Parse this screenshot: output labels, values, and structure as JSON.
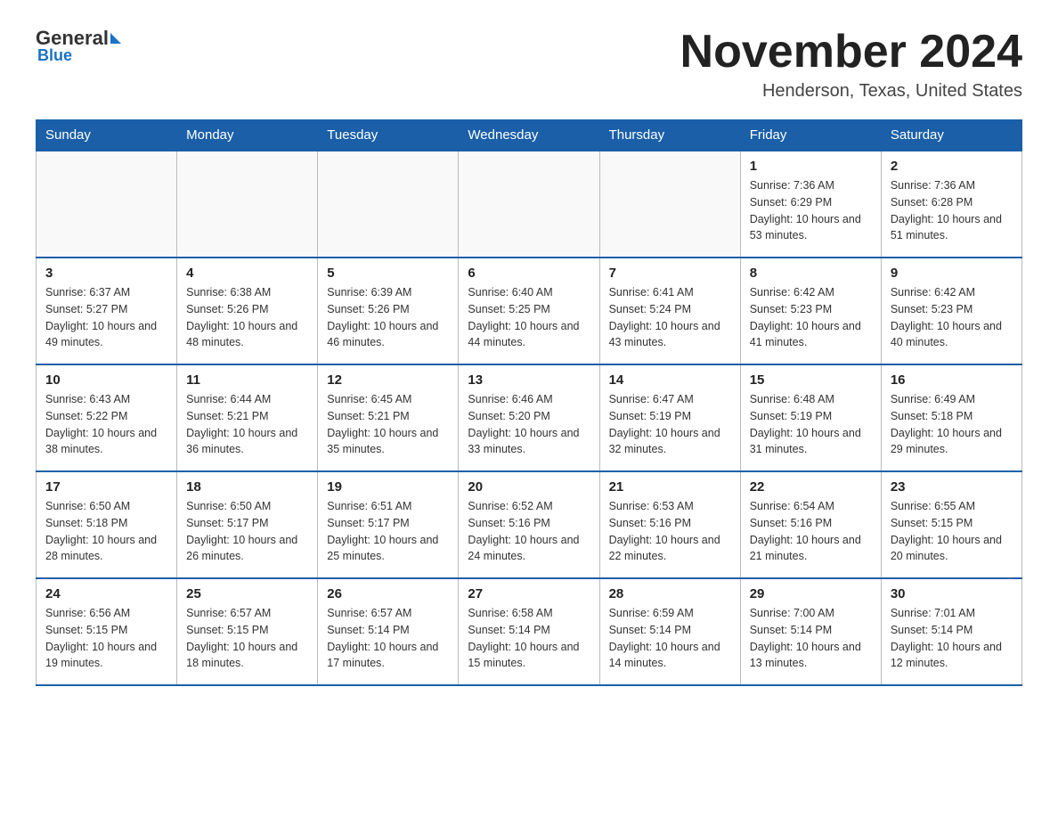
{
  "header": {
    "logo_general": "General",
    "logo_blue": "Blue",
    "month_title": "November 2024",
    "location": "Henderson, Texas, United States"
  },
  "calendar": {
    "days_of_week": [
      "Sunday",
      "Monday",
      "Tuesday",
      "Wednesday",
      "Thursday",
      "Friday",
      "Saturday"
    ],
    "weeks": [
      [
        {
          "day": "",
          "sunrise": "",
          "sunset": "",
          "daylight": ""
        },
        {
          "day": "",
          "sunrise": "",
          "sunset": "",
          "daylight": ""
        },
        {
          "day": "",
          "sunrise": "",
          "sunset": "",
          "daylight": ""
        },
        {
          "day": "",
          "sunrise": "",
          "sunset": "",
          "daylight": ""
        },
        {
          "day": "",
          "sunrise": "",
          "sunset": "",
          "daylight": ""
        },
        {
          "day": "1",
          "sunrise": "Sunrise: 7:36 AM",
          "sunset": "Sunset: 6:29 PM",
          "daylight": "Daylight: 10 hours and 53 minutes."
        },
        {
          "day": "2",
          "sunrise": "Sunrise: 7:36 AM",
          "sunset": "Sunset: 6:28 PM",
          "daylight": "Daylight: 10 hours and 51 minutes."
        }
      ],
      [
        {
          "day": "3",
          "sunrise": "Sunrise: 6:37 AM",
          "sunset": "Sunset: 5:27 PM",
          "daylight": "Daylight: 10 hours and 49 minutes."
        },
        {
          "day": "4",
          "sunrise": "Sunrise: 6:38 AM",
          "sunset": "Sunset: 5:26 PM",
          "daylight": "Daylight: 10 hours and 48 minutes."
        },
        {
          "day": "5",
          "sunrise": "Sunrise: 6:39 AM",
          "sunset": "Sunset: 5:26 PM",
          "daylight": "Daylight: 10 hours and 46 minutes."
        },
        {
          "day": "6",
          "sunrise": "Sunrise: 6:40 AM",
          "sunset": "Sunset: 5:25 PM",
          "daylight": "Daylight: 10 hours and 44 minutes."
        },
        {
          "day": "7",
          "sunrise": "Sunrise: 6:41 AM",
          "sunset": "Sunset: 5:24 PM",
          "daylight": "Daylight: 10 hours and 43 minutes."
        },
        {
          "day": "8",
          "sunrise": "Sunrise: 6:42 AM",
          "sunset": "Sunset: 5:23 PM",
          "daylight": "Daylight: 10 hours and 41 minutes."
        },
        {
          "day": "9",
          "sunrise": "Sunrise: 6:42 AM",
          "sunset": "Sunset: 5:23 PM",
          "daylight": "Daylight: 10 hours and 40 minutes."
        }
      ],
      [
        {
          "day": "10",
          "sunrise": "Sunrise: 6:43 AM",
          "sunset": "Sunset: 5:22 PM",
          "daylight": "Daylight: 10 hours and 38 minutes."
        },
        {
          "day": "11",
          "sunrise": "Sunrise: 6:44 AM",
          "sunset": "Sunset: 5:21 PM",
          "daylight": "Daylight: 10 hours and 36 minutes."
        },
        {
          "day": "12",
          "sunrise": "Sunrise: 6:45 AM",
          "sunset": "Sunset: 5:21 PM",
          "daylight": "Daylight: 10 hours and 35 minutes."
        },
        {
          "day": "13",
          "sunrise": "Sunrise: 6:46 AM",
          "sunset": "Sunset: 5:20 PM",
          "daylight": "Daylight: 10 hours and 33 minutes."
        },
        {
          "day": "14",
          "sunrise": "Sunrise: 6:47 AM",
          "sunset": "Sunset: 5:19 PM",
          "daylight": "Daylight: 10 hours and 32 minutes."
        },
        {
          "day": "15",
          "sunrise": "Sunrise: 6:48 AM",
          "sunset": "Sunset: 5:19 PM",
          "daylight": "Daylight: 10 hours and 31 minutes."
        },
        {
          "day": "16",
          "sunrise": "Sunrise: 6:49 AM",
          "sunset": "Sunset: 5:18 PM",
          "daylight": "Daylight: 10 hours and 29 minutes."
        }
      ],
      [
        {
          "day": "17",
          "sunrise": "Sunrise: 6:50 AM",
          "sunset": "Sunset: 5:18 PM",
          "daylight": "Daylight: 10 hours and 28 minutes."
        },
        {
          "day": "18",
          "sunrise": "Sunrise: 6:50 AM",
          "sunset": "Sunset: 5:17 PM",
          "daylight": "Daylight: 10 hours and 26 minutes."
        },
        {
          "day": "19",
          "sunrise": "Sunrise: 6:51 AM",
          "sunset": "Sunset: 5:17 PM",
          "daylight": "Daylight: 10 hours and 25 minutes."
        },
        {
          "day": "20",
          "sunrise": "Sunrise: 6:52 AM",
          "sunset": "Sunset: 5:16 PM",
          "daylight": "Daylight: 10 hours and 24 minutes."
        },
        {
          "day": "21",
          "sunrise": "Sunrise: 6:53 AM",
          "sunset": "Sunset: 5:16 PM",
          "daylight": "Daylight: 10 hours and 22 minutes."
        },
        {
          "day": "22",
          "sunrise": "Sunrise: 6:54 AM",
          "sunset": "Sunset: 5:16 PM",
          "daylight": "Daylight: 10 hours and 21 minutes."
        },
        {
          "day": "23",
          "sunrise": "Sunrise: 6:55 AM",
          "sunset": "Sunset: 5:15 PM",
          "daylight": "Daylight: 10 hours and 20 minutes."
        }
      ],
      [
        {
          "day": "24",
          "sunrise": "Sunrise: 6:56 AM",
          "sunset": "Sunset: 5:15 PM",
          "daylight": "Daylight: 10 hours and 19 minutes."
        },
        {
          "day": "25",
          "sunrise": "Sunrise: 6:57 AM",
          "sunset": "Sunset: 5:15 PM",
          "daylight": "Daylight: 10 hours and 18 minutes."
        },
        {
          "day": "26",
          "sunrise": "Sunrise: 6:57 AM",
          "sunset": "Sunset: 5:14 PM",
          "daylight": "Daylight: 10 hours and 17 minutes."
        },
        {
          "day": "27",
          "sunrise": "Sunrise: 6:58 AM",
          "sunset": "Sunset: 5:14 PM",
          "daylight": "Daylight: 10 hours and 15 minutes."
        },
        {
          "day": "28",
          "sunrise": "Sunrise: 6:59 AM",
          "sunset": "Sunset: 5:14 PM",
          "daylight": "Daylight: 10 hours and 14 minutes."
        },
        {
          "day": "29",
          "sunrise": "Sunrise: 7:00 AM",
          "sunset": "Sunset: 5:14 PM",
          "daylight": "Daylight: 10 hours and 13 minutes."
        },
        {
          "day": "30",
          "sunrise": "Sunrise: 7:01 AM",
          "sunset": "Sunset: 5:14 PM",
          "daylight": "Daylight: 10 hours and 12 minutes."
        }
      ]
    ]
  }
}
